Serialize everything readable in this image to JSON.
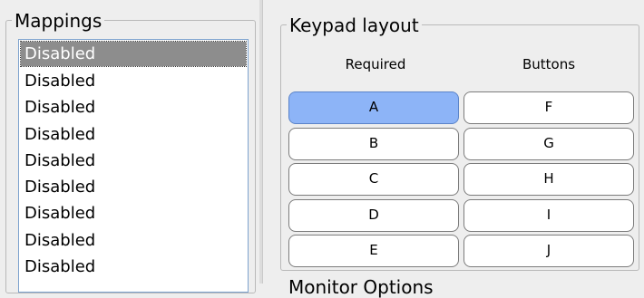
{
  "mappings": {
    "title": "Mappings",
    "items": [
      "Disabled",
      "Disabled",
      "Disabled",
      "Disabled",
      "Disabled",
      "Disabled",
      "Disabled",
      "Disabled",
      "Disabled"
    ],
    "selected_index": 0
  },
  "keypad": {
    "title": "Keypad layout",
    "col_required": "Required",
    "col_buttons": "Buttons",
    "required_keys": [
      "A",
      "B",
      "C",
      "D",
      "E"
    ],
    "button_keys": [
      "F",
      "G",
      "H",
      "I",
      "J"
    ],
    "active_key": "A"
  },
  "next_section": {
    "title": "Monitor Options"
  }
}
